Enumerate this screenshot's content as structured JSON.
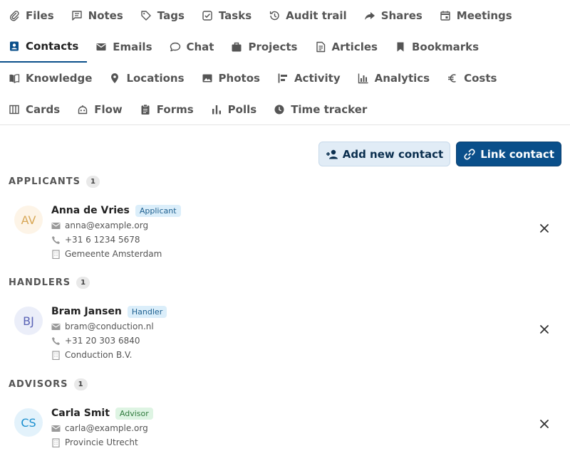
{
  "tabs": [
    [
      {
        "label": "Files",
        "icon": "paperclip-icon"
      },
      {
        "label": "Notes",
        "icon": "note-icon"
      },
      {
        "label": "Tags",
        "icon": "tag-icon"
      },
      {
        "label": "Tasks",
        "icon": "checkbox-icon"
      },
      {
        "label": "Audit trail",
        "icon": "history-icon"
      },
      {
        "label": "Shares",
        "icon": "share-icon"
      },
      {
        "label": "Meetings",
        "icon": "calendar-icon"
      }
    ],
    [
      {
        "label": "Contacts",
        "icon": "contact-card-icon",
        "active": true
      },
      {
        "label": "Emails",
        "icon": "email-icon"
      },
      {
        "label": "Chat",
        "icon": "chat-icon"
      },
      {
        "label": "Projects",
        "icon": "briefcase-icon"
      },
      {
        "label": "Articles",
        "icon": "document-icon"
      },
      {
        "label": "Bookmarks",
        "icon": "bookmark-icon"
      }
    ],
    [
      {
        "label": "Knowledge",
        "icon": "book-icon"
      },
      {
        "label": "Locations",
        "icon": "map-pin-icon"
      },
      {
        "label": "Photos",
        "icon": "image-icon"
      },
      {
        "label": "Activity",
        "icon": "timeline-icon"
      },
      {
        "label": "Analytics",
        "icon": "bar-chart-icon"
      },
      {
        "label": "Costs",
        "icon": "euro-icon"
      }
    ],
    [
      {
        "label": "Cards",
        "icon": "columns-icon"
      },
      {
        "label": "Flow",
        "icon": "robot-icon"
      },
      {
        "label": "Forms",
        "icon": "clipboard-icon"
      },
      {
        "label": "Polls",
        "icon": "poll-icon"
      },
      {
        "label": "Time tracker",
        "icon": "clock-icon"
      }
    ]
  ],
  "actions": {
    "add_new_contact": "Add new contact",
    "link_contact": "Link contact"
  },
  "sections": [
    {
      "title": "APPLICANTS",
      "count": "1",
      "contacts": [
        {
          "initials": "AV",
          "name": "Anna de Vries",
          "role": "Applicant",
          "email": "anna@example.org",
          "phone": "+31 6 1234 5678",
          "organization": "Gemeente Amsterdam",
          "avatar_bg": "#fdf4e7",
          "avatar_color": "#d8a858",
          "role_bg": "#dbeefa",
          "role_color": "#1d5f8f"
        }
      ]
    },
    {
      "title": "HANDLERS",
      "count": "1",
      "contacts": [
        {
          "initials": "BJ",
          "name": "Bram Jansen",
          "role": "Handler",
          "email": "bram@conduction.nl",
          "phone": "+31 20 303 6840",
          "organization": "Conduction B.V.",
          "avatar_bg": "#ebeef9",
          "avatar_color": "#5a63b5",
          "role_bg": "#dbeefa",
          "role_color": "#1d5f8f"
        }
      ]
    },
    {
      "title": "ADVISORS",
      "count": "1",
      "contacts": [
        {
          "initials": "CS",
          "name": "Carla Smit",
          "role": "Advisor",
          "email": "carla@example.org",
          "organization": "Provincie Utrecht",
          "avatar_bg": "#e3f2fb",
          "avatar_color": "#1a8fcf",
          "role_bg": "#def4e3",
          "role_color": "#2f7a3d"
        }
      ]
    }
  ]
}
